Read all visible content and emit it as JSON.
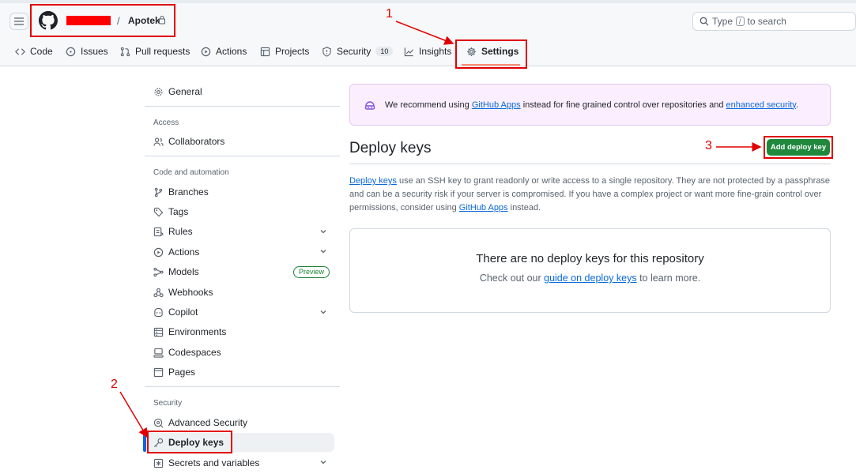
{
  "header": {
    "repo_separator": "/",
    "repo_name": "Apotek",
    "search_prefix": "Type",
    "search_key": "/",
    "search_suffix": "to search"
  },
  "nav": {
    "code": "Code",
    "issues": "Issues",
    "pull_requests": "Pull requests",
    "actions": "Actions",
    "projects": "Projects",
    "security": "Security",
    "security_count": "10",
    "insights": "Insights",
    "settings": "Settings"
  },
  "annotations": {
    "n1": "1",
    "n2": "2",
    "n3": "3"
  },
  "sidebar": {
    "general": "General",
    "section_access": "Access",
    "collaborators": "Collaborators",
    "section_code": "Code and automation",
    "branches": "Branches",
    "tags": "Tags",
    "rules": "Rules",
    "actions": "Actions",
    "models": "Models",
    "models_badge": "Preview",
    "webhooks": "Webhooks",
    "copilot": "Copilot",
    "environments": "Environments",
    "codespaces": "Codespaces",
    "pages": "Pages",
    "section_security": "Security",
    "advanced_security": "Advanced Security",
    "deploy_keys": "Deploy keys",
    "secrets": "Secrets and variables"
  },
  "main": {
    "banner_pre": "We recommend using",
    "banner_link1": "GitHub Apps",
    "banner_mid": "instead for fine grained control over repositories and",
    "banner_link2": "enhanced security",
    "banner_post": ".",
    "title": "Deploy keys",
    "add_button": "Add deploy key",
    "desc_link1": "Deploy keys",
    "desc_text1": "use an SSH key to grant readonly or write access to a single repository. They are not protected by a passphrase and can be a security risk if your server is compromised. If you have a complex project or want more fine-grain control over permissions, consider using",
    "desc_link2": "GitHub Apps",
    "desc_text2": "instead.",
    "empty_title": "There are no deploy keys for this repository",
    "empty_pre": "Check out our",
    "empty_link": "guide on deploy keys",
    "empty_post": "to learn more."
  },
  "colors": {
    "accent": "#0969da",
    "primary_button": "#1f883d",
    "annotation": "#e00000",
    "banner_bg": "#fbefff"
  }
}
